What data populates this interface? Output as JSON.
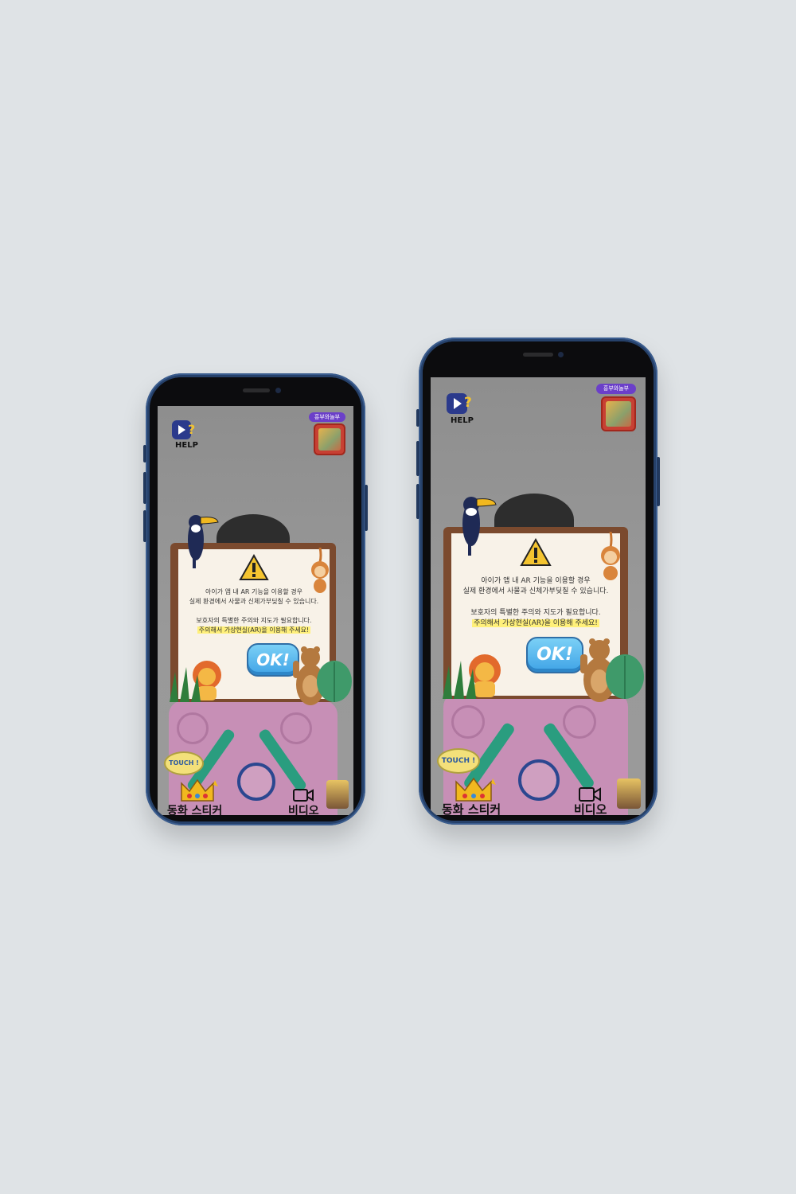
{
  "app": {
    "help_label": "HELP",
    "book_tag": "흥부와놀부",
    "warning_line1": "아이가 앱 내 AR 기능을 이용할 경우",
    "warning_line2": "실제 환경에서 사물과 신체가부딪칠 수 있습니다.",
    "warning_line3": "보호자의 특별한 주의와 지도가 필요합니다.",
    "warning_line4": "주의해서 가상현실(AR)을 이용해 주세요!",
    "ok_label": "OK!",
    "touch_label": "TOUCH !",
    "tab_sticker": "동화 스티커",
    "tab_video": "비디오"
  },
  "icons": {
    "help": "help-video-icon",
    "warning": "warning-triangle-icon",
    "video": "video-camera-icon",
    "crown": "crown-sticker-icon"
  },
  "colors": {
    "device_frame": "#26416a",
    "ok_button": "#3fa3e6",
    "board_frame": "#7b4a2e",
    "highlight": "#fff07a"
  }
}
